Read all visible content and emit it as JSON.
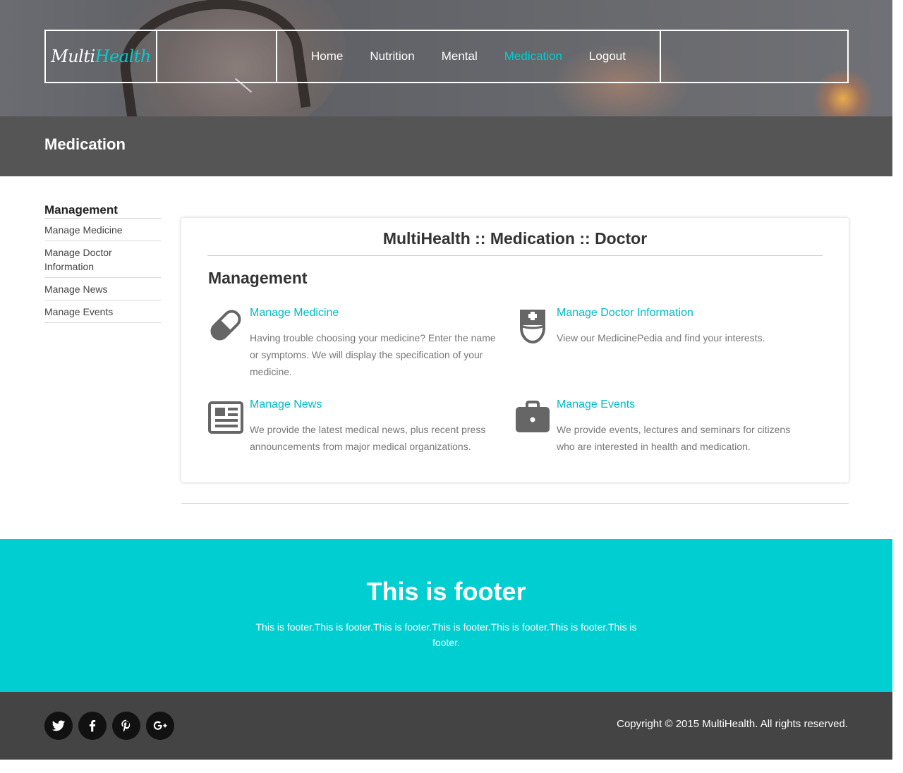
{
  "header": {
    "logo": {
      "part1": "Multi",
      "part2": "Health"
    },
    "nav": [
      {
        "label": "Home",
        "active": false
      },
      {
        "label": "Nutrition",
        "active": false
      },
      {
        "label": "Mental",
        "active": false
      },
      {
        "label": "Medication",
        "active": true
      },
      {
        "label": "Logout",
        "active": false
      }
    ]
  },
  "page_title": "Medication",
  "sidebar": {
    "heading": "Management",
    "items": [
      {
        "label": "Manage Medicine"
      },
      {
        "label": "Manage Doctor Information"
      },
      {
        "label": "Manage News"
      },
      {
        "label": "Manage Events"
      }
    ]
  },
  "main": {
    "title": "MultiHealth :: Medication :: Doctor",
    "subtitle": "Management",
    "features": [
      {
        "icon": "pill-icon",
        "title": "Manage Medicine",
        "description": "Having trouble choosing your medicine? Enter the name or symptoms. We will display the specification of your medicine."
      },
      {
        "icon": "doctor-icon",
        "title": "Manage Doctor Information",
        "description": "View our MedicinePedia and find your interests."
      },
      {
        "icon": "newspaper-icon",
        "title": "Manage News",
        "description": "We provide the latest medical news, plus recent press announcements from major medical organizations."
      },
      {
        "icon": "briefcase-icon",
        "title": "Manage Events",
        "description": "We provide events, lectures and seminars for citizens who are interested in health and medication."
      }
    ]
  },
  "footer": {
    "heading": "This is footer",
    "text": "This is footer.This is footer.This is footer.This is footer.This is footer.This is footer.This is footer.",
    "socials": [
      "twitter-icon",
      "facebook-icon",
      "pinterest-icon",
      "google-plus-icon"
    ],
    "copyright": "Copyright © 2015 MultiHealth. All rights reserved."
  },
  "colors": {
    "accent": "#00ced1",
    "title_bar": "#555555",
    "footer_bottom": "#444444",
    "icon_gray": "#666666"
  }
}
